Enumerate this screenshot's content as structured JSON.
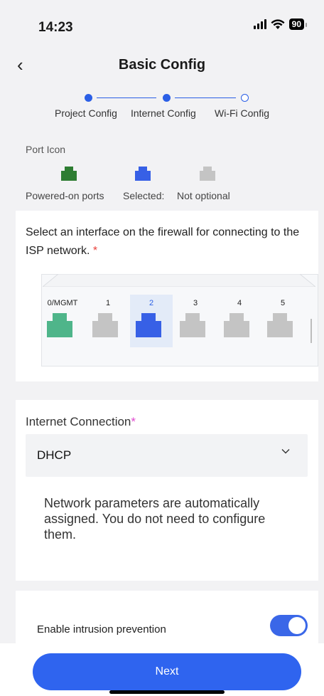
{
  "status_bar": {
    "time": "14:23",
    "battery": "90"
  },
  "nav": {
    "title": "Basic Config"
  },
  "stepper": {
    "steps": [
      {
        "label": "Project Config",
        "state": "done"
      },
      {
        "label": "Internet Config",
        "state": "current"
      },
      {
        "label": "Wi-Fi Config",
        "state": "pending"
      }
    ]
  },
  "legend": {
    "title": "Port Icon",
    "items": [
      {
        "label": "Powered-on ports",
        "color": "#2e7d32"
      },
      {
        "label": "Selected:",
        "color": "#3760e6"
      },
      {
        "label": "Not optional",
        "color": "#c4c4c4"
      }
    ]
  },
  "interface": {
    "prompt": "Select an interface on the firewall for connecting to the ISP network.",
    "required_mark": "*",
    "ports": [
      {
        "name": "0/MGMT",
        "state": "powered",
        "color": "#4fb58a"
      },
      {
        "name": "1",
        "state": "disabled",
        "color": "#c4c4c4"
      },
      {
        "name": "2",
        "state": "selected",
        "color": "#3760e6"
      },
      {
        "name": "3",
        "state": "disabled",
        "color": "#c4c4c4"
      },
      {
        "name": "4",
        "state": "disabled",
        "color": "#c4c4c4"
      },
      {
        "name": "5",
        "state": "disabled",
        "color": "#c4c4c4"
      }
    ]
  },
  "connection": {
    "label": "Internet Connection",
    "required_mark": "*",
    "value": "DHCP",
    "description": "Network parameters are automatically assigned. You do not need to configure them."
  },
  "intrusion": {
    "label": "Enable intrusion prevention",
    "enabled": true
  },
  "footer": {
    "next_label": "Next"
  },
  "colors": {
    "accent": "#2f64ef",
    "background": "#f2f2f4"
  }
}
